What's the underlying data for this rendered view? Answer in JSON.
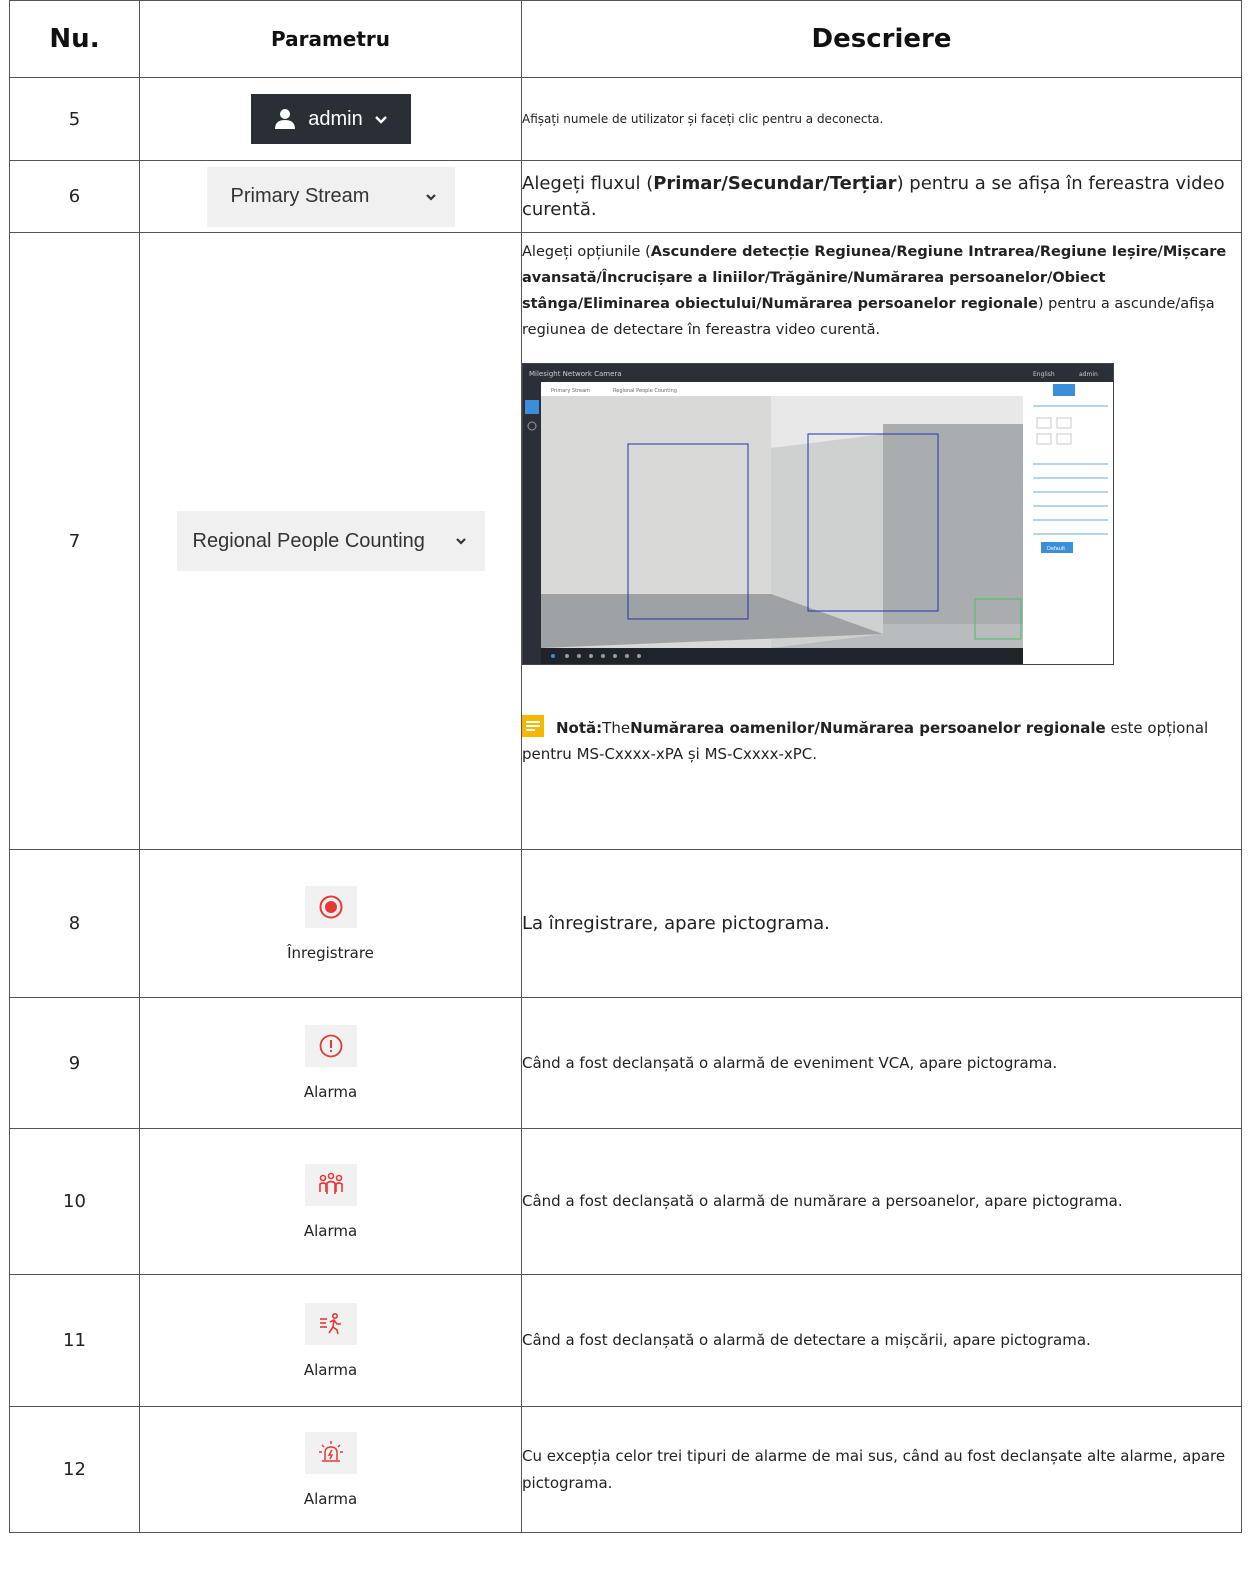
{
  "header": {
    "col1": "Nu.",
    "col2": "Parametru",
    "col3": "Descriere"
  },
  "rows": [
    {
      "num": "5",
      "param": {
        "label": "admin",
        "icon": "user-icon"
      },
      "desc": "Afișați numele de utilizator și faceți clic pentru a deconecta."
    },
    {
      "num": "6",
      "param": {
        "label": "Primary Stream"
      },
      "desc_pre": "Alegeți fluxul (",
      "desc_bold": "Primar/Secundar/Terțiar",
      "desc_post": ") pentru a se afișa în fereastra video curentă."
    },
    {
      "num": "7",
      "param": {
        "label": "Regional People Counting"
      },
      "desc_pre": "Alegeți opțiunile (",
      "desc_bold": "Ascundere detecție Regiunea/Regiune Intrarea/Regiune Ieșire/Mișcare avansată/Încrucișare a liniilor/Trăgănire/Numărarea persoanelor/Obiect stânga/Eliminarea obiectului/Numărarea persoanelor regionale",
      "desc_post": ") pentru a ascunde/afișa regiunea de detectare în fereastra video curentă.",
      "note_label": "Notă:",
      "note_pre": "The",
      "note_bold": "Numărarea oamenilor/Numărarea persoanelor regionale",
      "note_post": " este opțional pentru MS-Cxxxx-xPA și MS-Cxxxx-xPC.",
      "screenshot": {
        "brand": "Milesight Network Camera",
        "lang": "English",
        "user": "admin",
        "stream": "Primary Stream",
        "region": "Regional People Counting",
        "button": "Default"
      }
    },
    {
      "num": "8",
      "param": {
        "label": "Înregistrare",
        "icon": "record-icon"
      },
      "desc": "La înregistrare, apare pictograma."
    },
    {
      "num": "9",
      "param": {
        "label": "Alarma",
        "icon": "alert-icon"
      },
      "desc": "Când a fost declanșată o alarmă de eveniment VCA, apare pictograma."
    },
    {
      "num": "10",
      "param": {
        "label": "Alarma",
        "icon": "people-counting-icon"
      },
      "desc": "Când a fost declanșată o alarmă de numărare a persoanelor, apare pictograma."
    },
    {
      "num": "11",
      "param": {
        "label": "Alarma",
        "icon": "motion-icon"
      },
      "desc": "Când a fost declanșată o alarmă de detectare a mișcării, apare pictograma."
    },
    {
      "num": "12",
      "param": {
        "label": "Alarma",
        "icon": "siren-icon"
      },
      "desc": "Cu excepția celor trei tipuri de alarme de mai sus, când au fost declanșate alte alarme, apare pictograma."
    }
  ],
  "colors": {
    "accent_red": "#e53935",
    "dark_button": "#2a2f36",
    "note_yellow": "#f5b800"
  }
}
